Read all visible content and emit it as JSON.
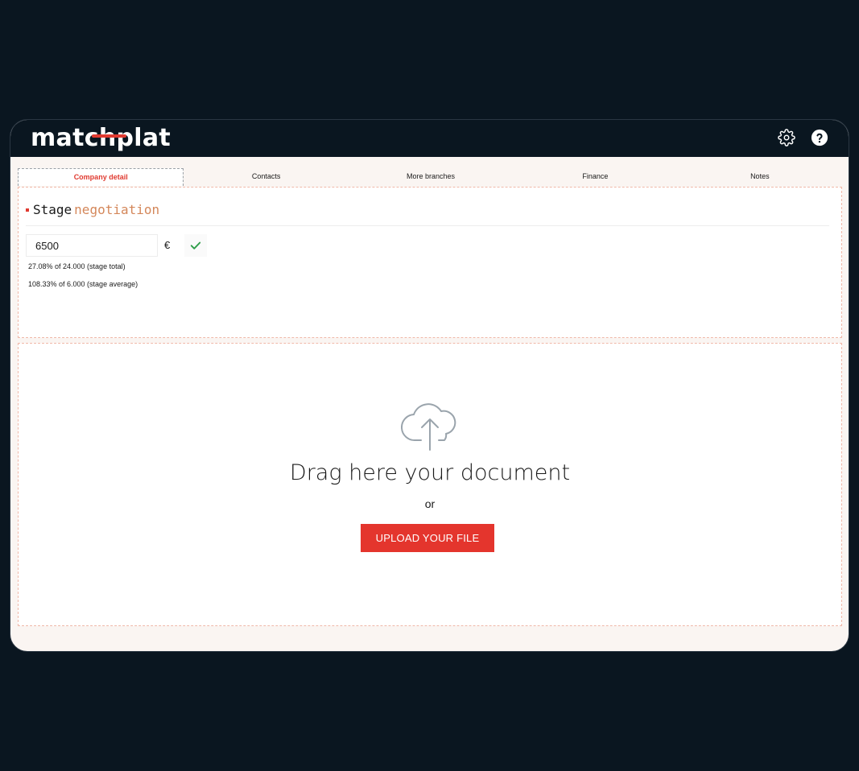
{
  "brand": {
    "logo_text": "matchplat",
    "accent": "#e03a30"
  },
  "header": {
    "icons": [
      {
        "name": "gear-icon",
        "label": "Settings"
      },
      {
        "name": "help-icon",
        "label": "Help"
      }
    ]
  },
  "tabs": [
    {
      "label": "Company detail",
      "active": true
    },
    {
      "label": "Contacts",
      "active": false
    },
    {
      "label": "More branches",
      "active": false
    },
    {
      "label": "Finance",
      "active": false
    },
    {
      "label": "Notes",
      "active": false
    }
  ],
  "stage": {
    "label": "Stage",
    "value": "negotiation",
    "amount": "6500",
    "currency": "€",
    "stats": [
      "27.08% of 24.000 (stage total)",
      "108.33% of 6.000 (stage average)"
    ]
  },
  "upload": {
    "title": "Drag here your document",
    "or": "or",
    "button_label": "UPLOAD YOUR FILE",
    "icon": "cloud-upload-icon"
  }
}
